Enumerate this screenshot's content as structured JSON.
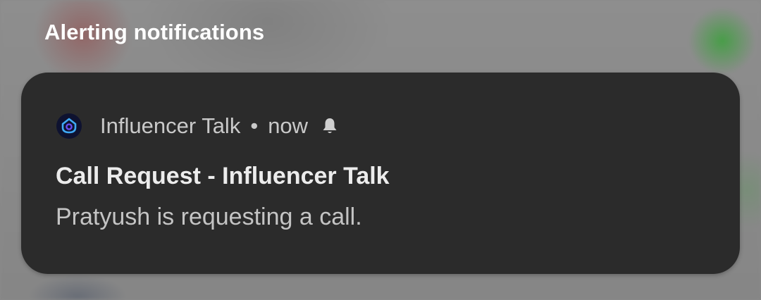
{
  "section": {
    "header": "Alerting notifications"
  },
  "notification": {
    "app_name": "Influencer Talk",
    "separator": "•",
    "time": "now",
    "app_icon": "influencer-talk-app-icon",
    "alert_icon": "bell-icon",
    "title": "Call Request - Influencer Talk",
    "text": "Pratyush is requesting a call."
  },
  "colors": {
    "card_background": "#2b2b2b",
    "header_text": "#ffffff",
    "secondary_text": "#c9c9c9",
    "icon_accent": "#3fa9f5"
  }
}
